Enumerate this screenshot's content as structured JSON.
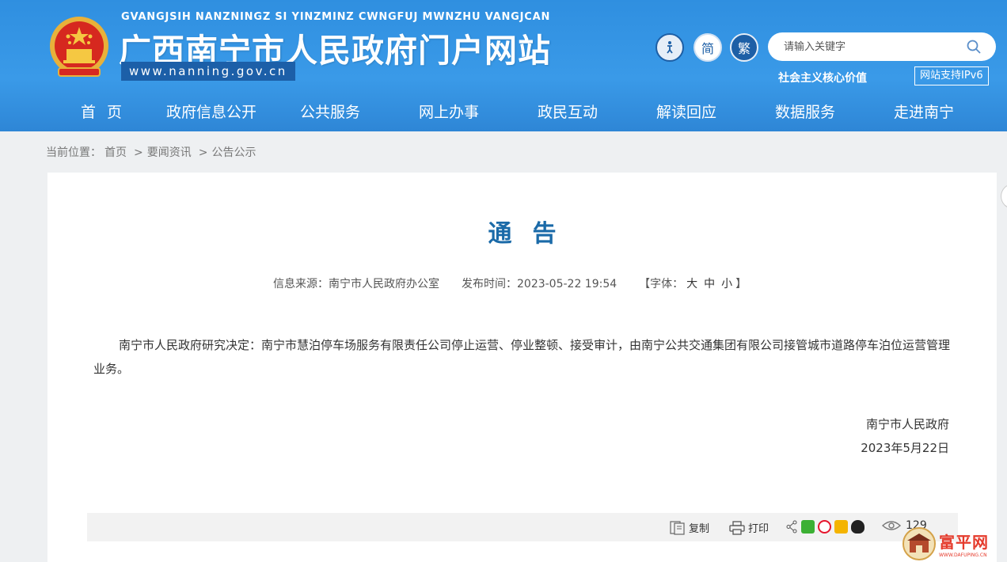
{
  "header": {
    "pinyin": "GVANGJSIH NANZNINGZ SI YINZMINZ CWNGFUJ MWNZHU VANGJCAN",
    "site_title": "广西南宁市人民政府门户网站",
    "domain": "www.nanning.gov.cn",
    "accessibility_icon": "accessibility-icon",
    "simplified_label": "简",
    "traditional_label": "繁",
    "search_placeholder": "请输入关键字",
    "values_text": "社会主义核心价值",
    "ipv6_label": "网站支持IPv6"
  },
  "nav": {
    "items": [
      "首页",
      "政府信息公开",
      "公共服务",
      "网上办事",
      "政民互动",
      "解读回应",
      "数据服务",
      "走进南宁"
    ]
  },
  "breadcrumb": {
    "prefix": "当前位置：",
    "items": [
      "首页",
      "要闻资讯",
      "公告公示"
    ],
    "separator": ">"
  },
  "article": {
    "title": "通告",
    "source_label": "信息来源：南宁市人民政府办公室",
    "date_label": "发布时间：2023-05-22 19:54",
    "font_label_open": "【字体：",
    "font_large": "大",
    "font_medium": "中",
    "font_small": "小",
    "font_label_close": "】",
    "body": "南宁市人民政府研究决定：南宁市慧泊停车场服务有限责任公司停止运营、停业整顿、接受审计，由南宁公共交通集团有限公司接管城市道路停车泊位运营管理业务。",
    "signature": "南宁市人民政府",
    "sign_date": "2023年5月22日"
  },
  "toolbar": {
    "copy_label": "复制",
    "print_label": "打印",
    "view_count": "129"
  },
  "watermark": {
    "text": "富平网",
    "sub": "WWW.DAFUPING.CN"
  },
  "colors": {
    "header_blue": "#2f8fe0",
    "title_blue": "#1a6aa8",
    "brand_red": "#e53b2c"
  }
}
